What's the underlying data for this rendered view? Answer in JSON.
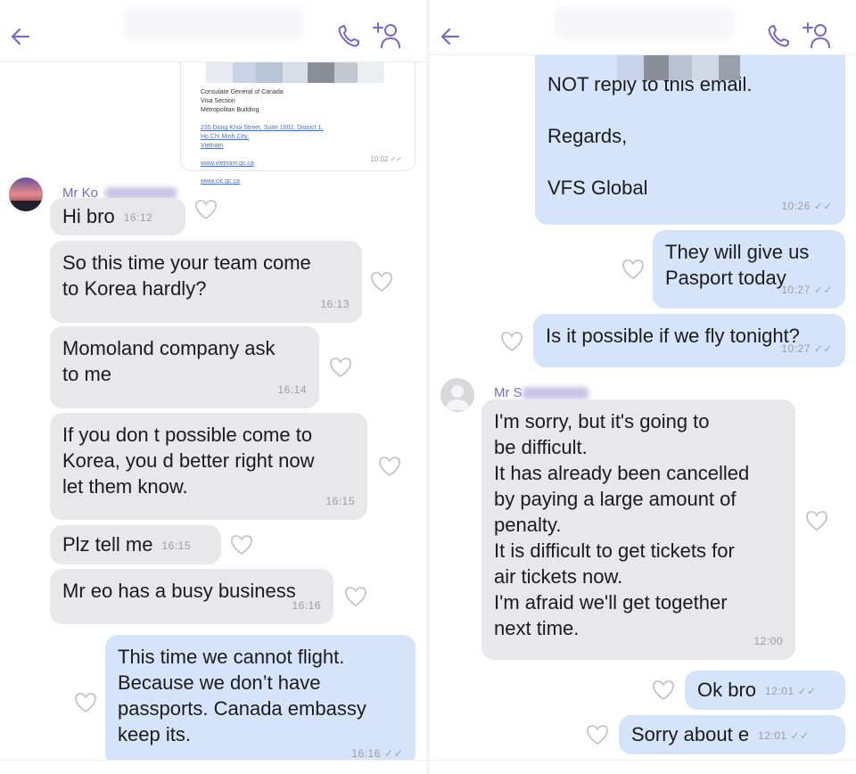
{
  "colors": {
    "incoming_bubble": "#e8e8ea",
    "outgoing_bubble": "#d6e4fb",
    "accent_icon": "#7a68c4",
    "sender_name": "#7a68c4",
    "timestamp": "#9c9ca4"
  },
  "icons": {
    "back": "arrow-left-icon",
    "call": "phone-icon",
    "add_participant": "add-user-icon",
    "like": "heart-outline-icon",
    "read_receipt": "double-check-icon"
  },
  "left_chat": {
    "email_card": {
      "address_lines": "Consulate General of Canada\nVisa Section\nMetropolitan Building",
      "address_link": "235 Dong Khoi Street, Suite 1002, District 1,\nHo Chi Minh City,\nVietnam",
      "web1": "www.vietnam.gc.ca",
      "web2": "www.cic.gc.ca",
      "time": "10:02"
    },
    "sender": "Mr Ko",
    "messages": [
      {
        "text": "Hi bro",
        "time": "16:12"
      },
      {
        "text": "So this time your team come\nto Korea hardly?",
        "time": "16:13"
      },
      {
        "text": "Momoland company ask\nto me",
        "time": "16:14"
      },
      {
        "text": "If you don t  possible come to\nKorea, you d better right now\nlet them know.",
        "time": "16:15"
      },
      {
        "text": "Plz tell me",
        "time": "16:15"
      },
      {
        "text": "Mr eo has a busy business",
        "time": "16:16"
      },
      {
        "text": "This time we cannot flight.\nBecause we don’t have\npassports. Canada embassy\nkeep its.",
        "time": "16:16"
      }
    ]
  },
  "right_chat": {
    "email_tail": {
      "text": "NOT reply to this email.\n\nRegards,\n\nVFS Global",
      "time": "10:26"
    },
    "sender": "Mr S",
    "messages": [
      {
        "text": "They will give us\nPasport today",
        "time": "10:27"
      },
      {
        "text": "Is it possible if we fly tonight?",
        "time": "10:27"
      },
      {
        "text": "I'm sorry, but it's going to\nbe difficult.\nIt has already been cancelled\nby paying a large amount of\npenalty.\nIt is difficult to get tickets for\nair tickets now.\nI'm afraid we'll get together\nnext time.",
        "time": "12:00"
      },
      {
        "text": "Ok bro",
        "time": "12:01"
      },
      {
        "text": "Sorry about e",
        "time": "12:01"
      }
    ]
  }
}
